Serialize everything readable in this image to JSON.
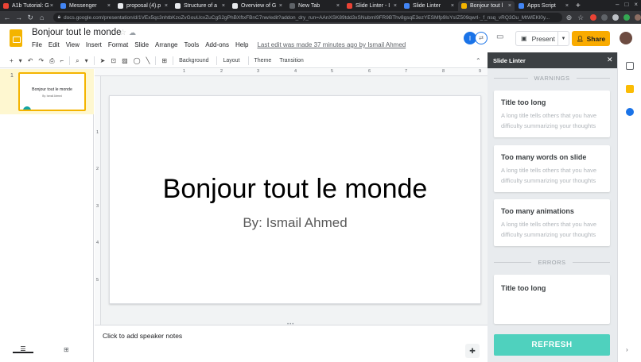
{
  "browser": {
    "tabs": [
      {
        "label": "A1b Tutorial: G",
        "color": "#ea4335"
      },
      {
        "label": "Messenger",
        "color": "#4285f4"
      },
      {
        "label": "proposal (4).p",
        "color": "#e8eaed"
      },
      {
        "label": "Structure of a",
        "color": "#e8eaed"
      },
      {
        "label": "Overview of G",
        "color": "#e8eaed"
      },
      {
        "label": "New Tab",
        "color": "#35363a"
      },
      {
        "label": "Slide Linter - I",
        "color": "#ea4335"
      },
      {
        "label": "Slide Linter",
        "color": "#4285f4"
      },
      {
        "label": "Bonjour tout l",
        "color": "#f4b400"
      },
      {
        "label": "Apps Script",
        "color": "#4285f4"
      }
    ],
    "new_tab": "+",
    "url": "docs.google.com/presentation/d/1VEx5qc3nhtbKzoZvGouUcvZuCgS2gPhBXftxFBnC7nw/edit?addon_dry_run=AAnXSK89tdd3xSNubmI9FR9BThv8gsqE3ezYESMfp9lsYsIZ509qwrI-_f_nsq_vRQ3Ou_MtWEKl0y..."
  },
  "app": {
    "doc_title": "Bonjour tout le monde",
    "menu": [
      "File",
      "Edit",
      "View",
      "Insert",
      "Format",
      "Slide",
      "Arrange",
      "Tools",
      "Add-ons",
      "Help"
    ],
    "last_edit": "Last edit was made 37 minutes ago by Ismail Ahmed",
    "avatar_letter": "I",
    "present_label": "Present",
    "share_label": "Share"
  },
  "toolbar": {
    "background": "Background",
    "layout": "Layout",
    "theme": "Theme",
    "transition": "Transition"
  },
  "ruler": {
    "h": [
      "1",
      "2",
      "3",
      "4",
      "5",
      "6",
      "7",
      "8",
      "9"
    ],
    "v": [
      "1",
      "2",
      "3",
      "4",
      "5"
    ]
  },
  "filmstrip": {
    "slide_number": "1",
    "thumb_title": "Bonjour tout le monde",
    "thumb_sub": "By: Ismail Ahmed"
  },
  "slide": {
    "title": "Bonjour tout le monde",
    "subtitle": "By: Ismail Ahmed"
  },
  "notes": {
    "placeholder": "Click to add speaker notes"
  },
  "sidebar": {
    "title": "Slide Linter",
    "warnings_label": "WARNINGS",
    "errors_label": "ERRORS",
    "warnings": [
      {
        "title": "Title too long",
        "desc": "A long title tells others that you have difficulty summarizing your thoughts"
      },
      {
        "title": "Too many words on slide",
        "desc": "A long title tells others that you have difficulty summarizing your thoughts"
      },
      {
        "title": "Too many animations",
        "desc": "A long title tells others that you have difficulty summarizing your thoughts"
      }
    ],
    "errors": [
      {
        "title": "Title too long"
      }
    ],
    "refresh_label": "REFRESH",
    "accent": "#4fd1be"
  }
}
